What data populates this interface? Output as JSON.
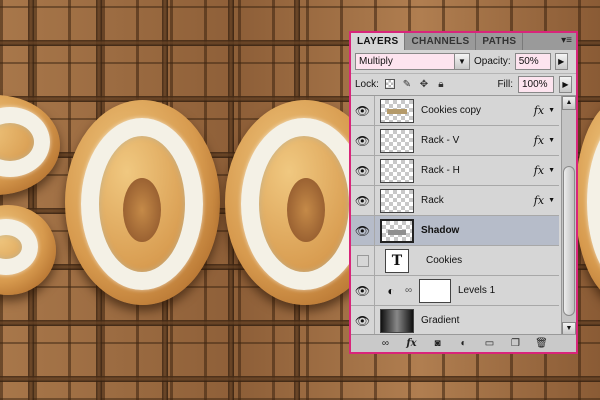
{
  "panel": {
    "tabs": [
      "LAYERS",
      "CHANNELS",
      "PATHS"
    ],
    "menu_icon": "panel-menu-icon",
    "blend_mode": "Multiply",
    "opacity_label": "Opacity:",
    "opacity_value": "50%",
    "lock_label": "Lock:",
    "fill_label": "Fill:",
    "fill_value": "100%"
  },
  "layers": [
    {
      "name": "Cookies copy",
      "visible": true,
      "thumb": "strip",
      "fx": true,
      "selected": false
    },
    {
      "name": "Rack - V",
      "visible": true,
      "thumb": "transparent",
      "fx": true,
      "selected": false
    },
    {
      "name": "Rack - H",
      "visible": true,
      "thumb": "transparent",
      "fx": true,
      "selected": false
    },
    {
      "name": "Rack",
      "visible": true,
      "thumb": "transparent",
      "fx": true,
      "selected": false
    },
    {
      "name": "Shadow",
      "visible": true,
      "thumb": "strip",
      "fx": false,
      "selected": true
    },
    {
      "name": "Cookies",
      "visible": false,
      "thumb": "text",
      "thumb_text": "T",
      "fx": false,
      "selected": false
    },
    {
      "name": "Levels 1",
      "visible": true,
      "thumb": "adjustment",
      "fx": false,
      "selected": false
    },
    {
      "name": "Gradient",
      "visible": true,
      "thumb": "gradient",
      "fx": false,
      "selected": false
    }
  ],
  "fx_label": "fx",
  "colors": {
    "panel_border": "#d9257a",
    "selected_row": "#b6bcc9",
    "field_bg": "#fde4ef",
    "icing": "#f4f1e6",
    "cookie": "#d79a4e"
  }
}
